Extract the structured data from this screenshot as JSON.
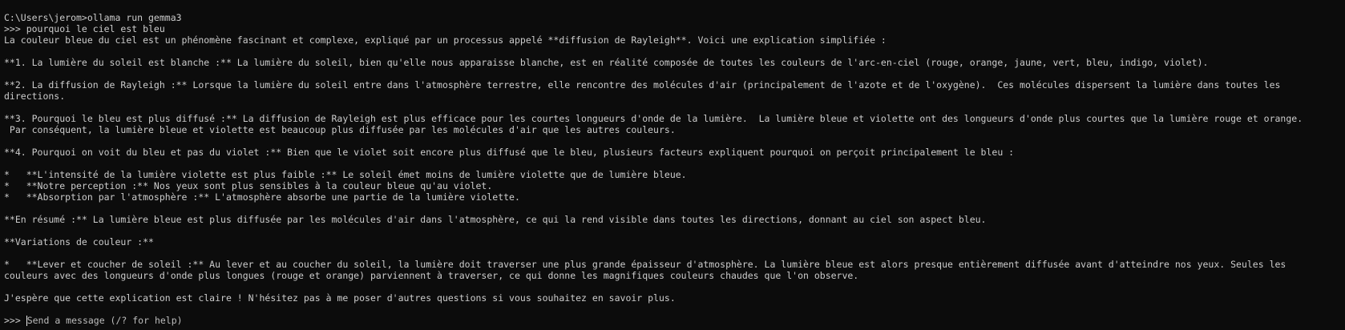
{
  "lines": [
    "C:\\Users\\jerom>ollama run gemma3",
    ">>> pourquoi le ciel est bleu",
    "La couleur bleue du ciel est un phénomène fascinant et complexe, expliqué par un processus appelé **diffusion de Rayleigh**. Voici une explication simplifiée :",
    "",
    "**1. La lumière du soleil est blanche :** La lumière du soleil, bien qu'elle nous apparaisse blanche, est en réalité composée de toutes les couleurs de l'arc-en-ciel (rouge, orange, jaune, vert, bleu, indigo, violet).",
    "",
    "**2. La diffusion de Rayleigh :** Lorsque la lumière du soleil entre dans l'atmosphère terrestre, elle rencontre des molécules d'air (principalement de l'azote et de l'oxygène).  Ces molécules dispersent la lumière dans toutes les",
    "directions.",
    "",
    "**3. Pourquoi le bleu est plus diffusé :** La diffusion de Rayleigh est plus efficace pour les courtes longueurs d'onde de la lumière.  La lumière bleue et violette ont des longueurs d'onde plus courtes que la lumière rouge et orange.",
    " Par conséquent, la lumière bleue et violette est beaucoup plus diffusée par les molécules d'air que les autres couleurs.",
    "",
    "**4. Pourquoi on voit du bleu et pas du violet :** Bien que le violet soit encore plus diffusé que le bleu, plusieurs facteurs expliquent pourquoi on perçoit principalement le bleu :",
    "",
    "*   **L'intensité de la lumière violette est plus faible :** Le soleil émet moins de lumière violette que de lumière bleue.",
    "*   **Notre perception :** Nos yeux sont plus sensibles à la couleur bleue qu'au violet.",
    "*   **Absorption par l'atmosphère :** L'atmosphère absorbe une partie de la lumière violette.",
    "",
    "**En résumé :** La lumière bleue est plus diffusée par les molécules d'air dans l'atmosphère, ce qui la rend visible dans toutes les directions, donnant au ciel son aspect bleu.",
    "",
    "**Variations de couleur :**",
    "",
    "*   **Lever et coucher de soleil :** Au lever et au coucher du soleil, la lumière doit traverser une plus grande épaisseur d'atmosphère. La lumière bleue est alors presque entièrement diffusée avant d'atteindre nos yeux. Seules les",
    "couleurs avec des longueurs d'onde plus longues (rouge et orange) parviennent à traverser, ce qui donne les magnifiques couleurs chaudes que l'on observe.",
    "",
    "J'espère que cette explication est claire ! N'hésitez pas à me poser d'autres questions si vous souhaitez en savoir plus.",
    ""
  ],
  "input": {
    "prompt": ">>> ",
    "placeholder": "Send a message (/? for help)"
  },
  "colors": {
    "background": "#0c0c0c",
    "text": "#cccccc"
  }
}
